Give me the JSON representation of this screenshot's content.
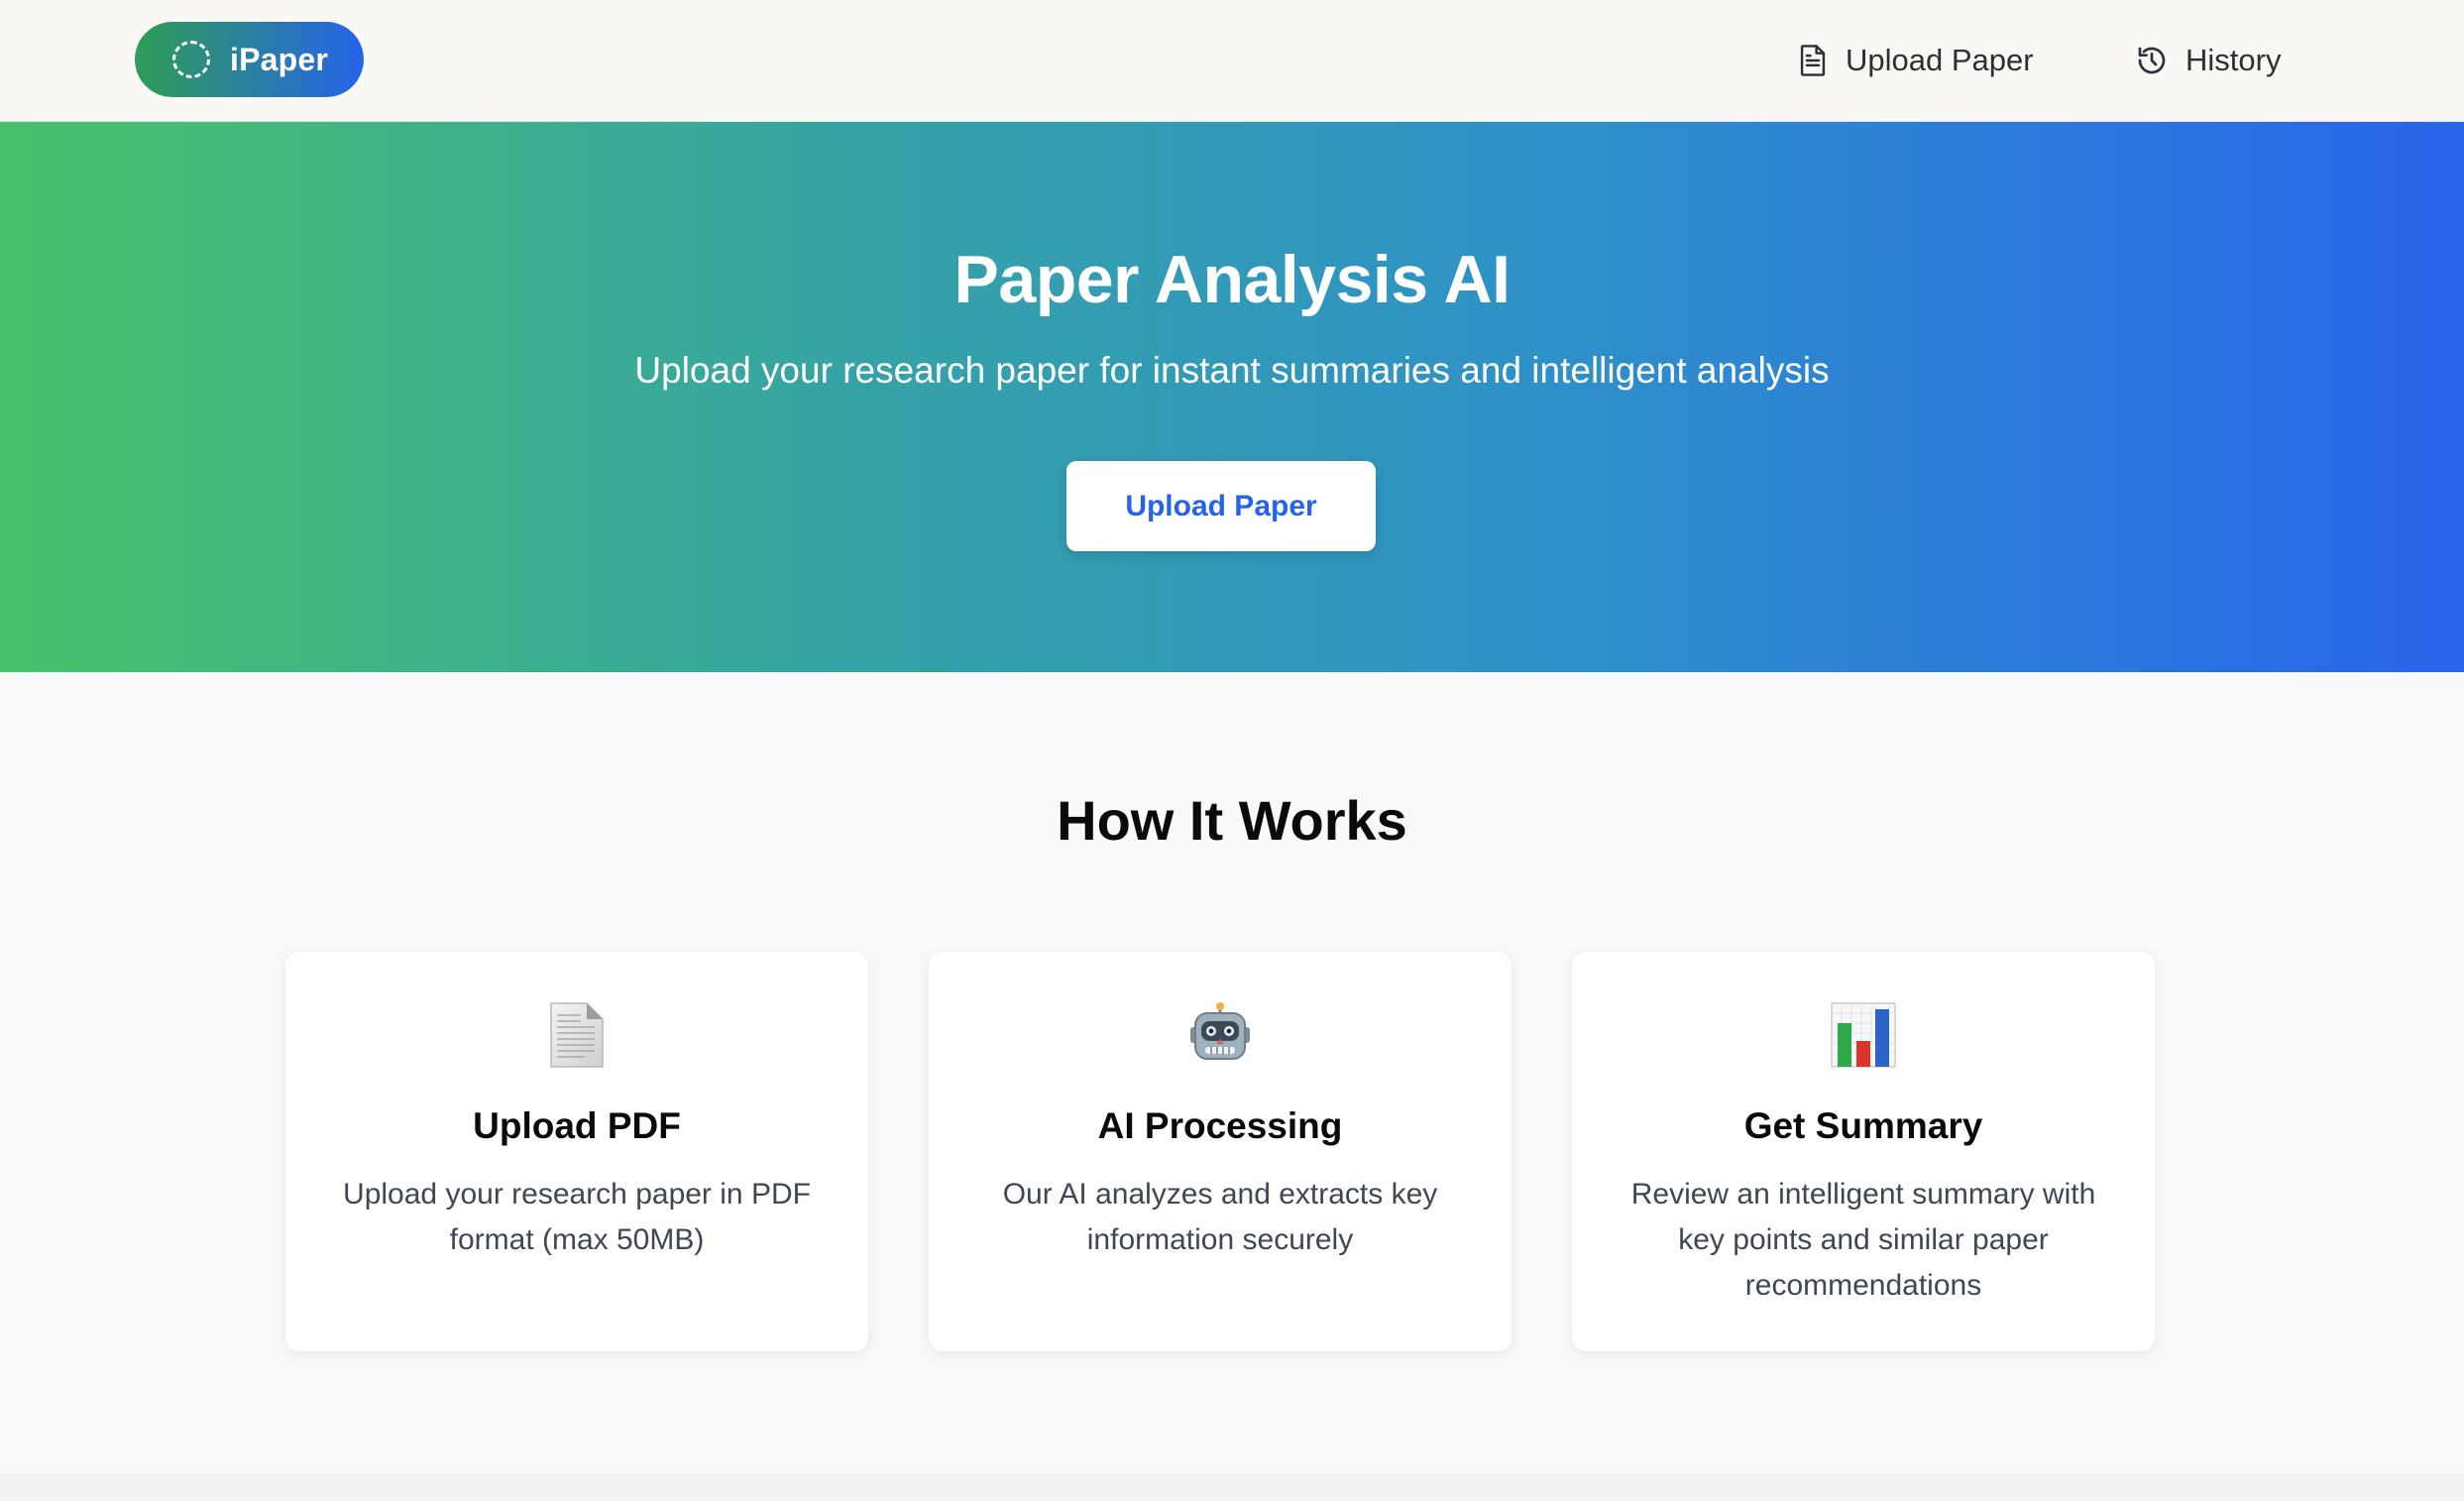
{
  "brand": {
    "name": "iPaper",
    "gradient_start": "#2f9d55",
    "gradient_end": "#2663ea"
  },
  "nav": {
    "items": [
      {
        "label": "Upload Paper",
        "icon": "document-icon"
      },
      {
        "label": "History",
        "icon": "history-icon"
      }
    ]
  },
  "hero": {
    "title": "Paper Analysis AI",
    "subtitle": "Upload your research paper for instant summaries and intelligent analysis",
    "button_label": "Upload Paper",
    "accent": "#2563eb"
  },
  "how_it_works": {
    "title": "How It Works",
    "cards": [
      {
        "icon": "page-icon",
        "title": "Upload PDF",
        "description": "Upload your research paper in PDF format (max 50MB)"
      },
      {
        "icon": "robot-icon",
        "title": "AI Processing",
        "description": "Our AI analyzes and extracts key information securely"
      },
      {
        "icon": "bar-chart-icon",
        "title": "Get Summary",
        "description": "Review an intelligent summary with key points and similar paper recommendations"
      }
    ]
  }
}
